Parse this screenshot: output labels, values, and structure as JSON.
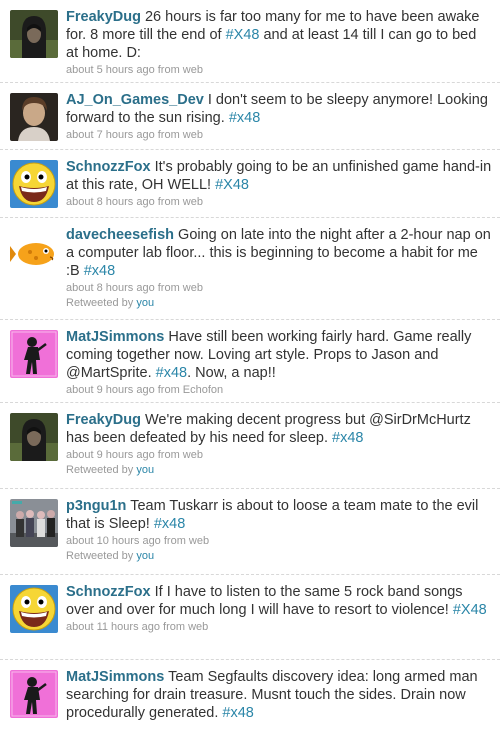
{
  "tweets": [
    {
      "user": "FreakyDug",
      "avatar": "hooded-figure",
      "text_a": "26 hours is far too many for me to have been awake for. 8 more till the end of ",
      "tag1": "#X48",
      "text_b": " and at least 14 till I can go to bed at home. D:",
      "meta": "about 5 hours ago from web"
    },
    {
      "user": "AJ_On_Games_Dev",
      "avatar": "person-photo",
      "text_a": "I don't seem to be sleepy anymore! Looking forward to the sun rising. ",
      "tag1": "#x48",
      "text_b": "",
      "meta": "about 7 hours ago from web"
    },
    {
      "user": "SchnozzFox",
      "avatar": "awesome-face",
      "text_a": "It's probably going to be an unfinished game hand-in at this rate, OH WELL! ",
      "tag1": "#X48",
      "text_b": "",
      "meta": "about 8 hours ago from web"
    },
    {
      "user": "davecheesefish",
      "avatar": "cheese-fish",
      "text_a": "Going on late into the night after a 2-hour nap on a computer lab floor... this is beginning to become a habit for me :B ",
      "tag1": "#x48",
      "text_b": "",
      "meta": "about 8 hours ago from web",
      "rt_label": "Retweeted by",
      "rt_user": "you"
    },
    {
      "user": "MatJSimmons",
      "avatar": "pink-silhouette",
      "text_a": "Have still been working fairly hard. Game really coming together now. Loving art style. Props to Jason and @MartSprite. ",
      "tag1": "#x48",
      "text_b": ". Now, a nap!!",
      "meta": "about 9 hours ago from Echofon"
    },
    {
      "user": "FreakyDug",
      "avatar": "hooded-figure",
      "text_a": "We're making decent progress but @SirDrMcHurtz has been defeated by his need for sleep. ",
      "tag1": "#x48",
      "text_b": "",
      "meta": "about 9 hours ago from web",
      "rt_label": "Retweeted by",
      "rt_user": "you"
    },
    {
      "user": "p3ngu1n",
      "avatar": "team-photo",
      "text_a": "Team Tuskarr is about to loose a team mate to the evil that is Sleep! ",
      "tag1": "#x48",
      "text_b": "",
      "meta": "about 10 hours ago from web",
      "rt_label": "Retweeted by",
      "rt_user": "you"
    },
    {
      "user": "SchnozzFox",
      "avatar": "awesome-face",
      "text_a": "If I have to listen to the same 5 rock band songs over and over for much long I will have to resort to violence! ",
      "tag1": "#X48",
      "text_b": "",
      "meta": "about 11 hours ago from web"
    },
    {
      "user": "MatJSimmons",
      "avatar": "pink-silhouette",
      "text_a": "Team Segfaults discovery idea: long armed man searching for drain treasure. Musnt touch the sides. Drain now procedurally generated. ",
      "tag1": "#x48",
      "text_b": "",
      "meta": ""
    }
  ]
}
